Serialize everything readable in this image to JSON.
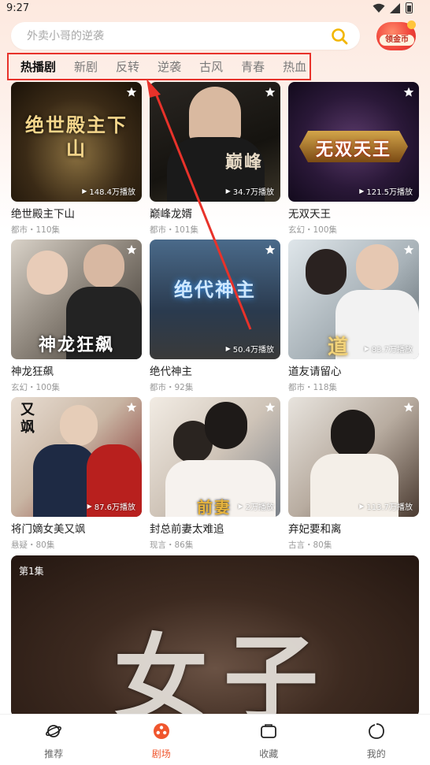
{
  "status": {
    "time": "9:27"
  },
  "search": {
    "placeholder": "外卖小哥的逆袭"
  },
  "coin": {
    "label": "领金币"
  },
  "tabs": [
    {
      "label": "热播剧",
      "active": true
    },
    {
      "label": "新剧"
    },
    {
      "label": "反转"
    },
    {
      "label": "逆袭"
    },
    {
      "label": "古风"
    },
    {
      "label": "青春"
    },
    {
      "label": "热血"
    }
  ],
  "cards": [
    {
      "title": "绝世殿主下山",
      "meta": "都市・110集",
      "plays": "148.4万播放",
      "art": "绝世殿主下山"
    },
    {
      "title": "巅峰龙婿",
      "meta": "都市・101集",
      "plays": "34.7万播放",
      "art": "巅峰"
    },
    {
      "title": "无双天王",
      "meta": "玄幻・100集",
      "plays": "121.5万播放",
      "art": "无双天王"
    },
    {
      "title": "神龙狂飙",
      "meta": "玄幻・100集",
      "plays": "",
      "art": "神龙狂飙"
    },
    {
      "title": "绝代神主",
      "meta": "都市・92集",
      "plays": "50.4万播放",
      "art": "绝代神主"
    },
    {
      "title": "道友请留心",
      "meta": "都市・118集",
      "plays": "83.7万播放",
      "art": "道"
    },
    {
      "title": "将门嫡女美又飒",
      "meta": "悬疑・80集",
      "plays": "87.6万播放",
      "art": "又飒"
    },
    {
      "title": "封总前妻太难追",
      "meta": "现言・86集",
      "plays": "2万播放",
      "art": "前妻"
    },
    {
      "title": "弃妃要和离",
      "meta": "古言・80集",
      "plays": "113.7万播放",
      "art": ""
    }
  ],
  "banner": {
    "episode": "第1集",
    "art": "女子"
  },
  "nav": [
    {
      "label": "推荐",
      "icon": "planet-icon"
    },
    {
      "label": "剧场",
      "icon": "film-reel-icon",
      "active": true
    },
    {
      "label": "收藏",
      "icon": "folder-icon"
    },
    {
      "label": "我的",
      "icon": "profile-icon"
    }
  ],
  "colors": {
    "accent": "#f0562e",
    "annotation_red": "#e8322a"
  }
}
